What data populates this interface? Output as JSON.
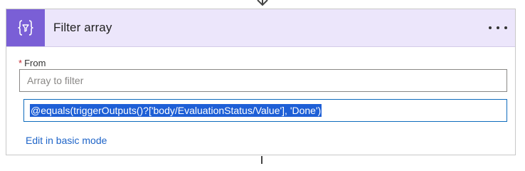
{
  "card": {
    "icon": "filter-curly-braces-icon",
    "title": "Filter array",
    "more_icon": "more-ellipsis-icon"
  },
  "from_field": {
    "required_marker": "*",
    "label": "From",
    "placeholder": "Array to filter"
  },
  "expression": {
    "value": "@equals(triggerOutputs()?['body/EvaluationStatus/Value'], 'Done')",
    "selected": true
  },
  "links": {
    "basic_mode": "Edit in basic mode"
  },
  "colors": {
    "header_bg": "#ece6fb",
    "icon_bg": "#7a5fd6",
    "link": "#1e64c8",
    "selection": "#1e5fd6",
    "focus_border": "#0f6cbd",
    "required": "#c4262e"
  }
}
